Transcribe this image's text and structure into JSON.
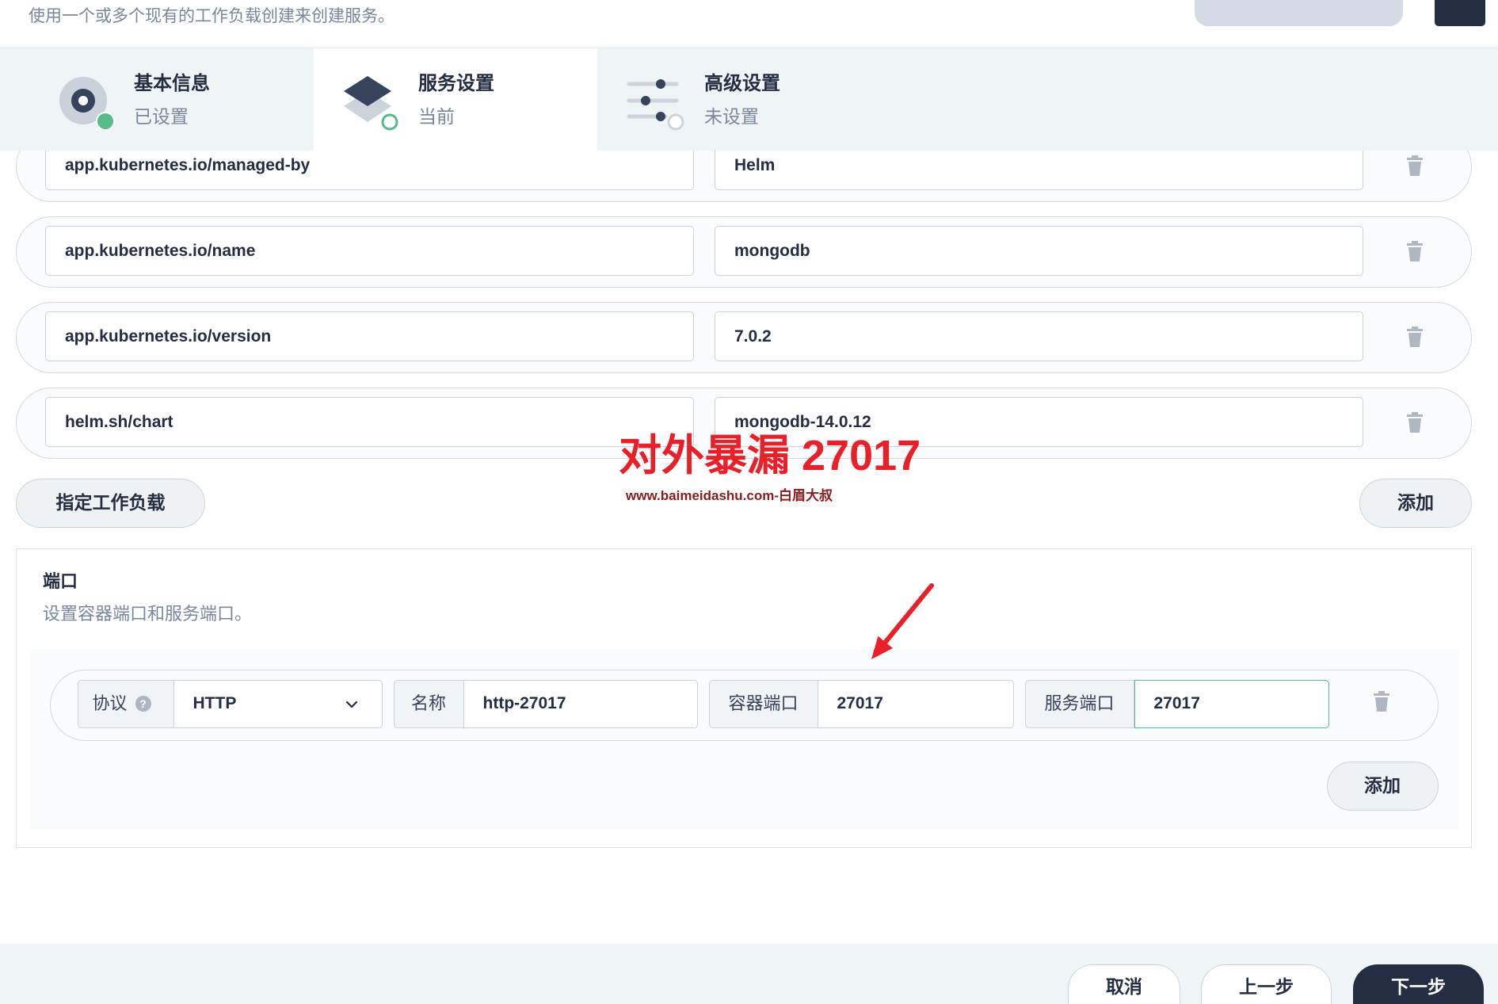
{
  "header": {
    "subtitle": "使用一个或多个现有的工作负载创建来创建服务。"
  },
  "steps": [
    {
      "title": "基本信息",
      "status": "已设置",
      "icon": "info-circle-icon"
    },
    {
      "title": "服务设置",
      "status": "当前",
      "icon": "layers-icon"
    },
    {
      "title": "高级设置",
      "status": "未设置",
      "icon": "sliders-icon"
    }
  ],
  "labels": [
    {
      "key": "app.kubernetes.io/managed-by",
      "value": "Helm"
    },
    {
      "key": "app.kubernetes.io/name",
      "value": "mongodb"
    },
    {
      "key": "app.kubernetes.io/version",
      "value": "7.0.2"
    },
    {
      "key": "helm.sh/chart",
      "value": "mongodb-14.0.12"
    }
  ],
  "label_actions": {
    "specify_workload": "指定工作负载",
    "add": "添加"
  },
  "annotation": {
    "text": "对外暴漏 27017",
    "source": "www.baimeidashu.com-白眉大叔"
  },
  "ports": {
    "title": "端口",
    "description": "设置容器端口和服务端口。",
    "items": [
      {
        "protocol_label": "协议",
        "protocol": "HTTP",
        "name_label": "名称",
        "name": "http-27017",
        "container_port_label": "容器端口",
        "container_port": "27017",
        "service_port_label": "服务端口",
        "service_port": "27017"
      }
    ],
    "add": "添加"
  },
  "footer": {
    "cancel": "取消",
    "previous": "上一步",
    "next": "下一步"
  },
  "colors": {
    "accent_green": "#55bc8a",
    "primary_dark": "#242e42",
    "annotation_red": "#e8202a",
    "muted_text": "#79879c"
  }
}
